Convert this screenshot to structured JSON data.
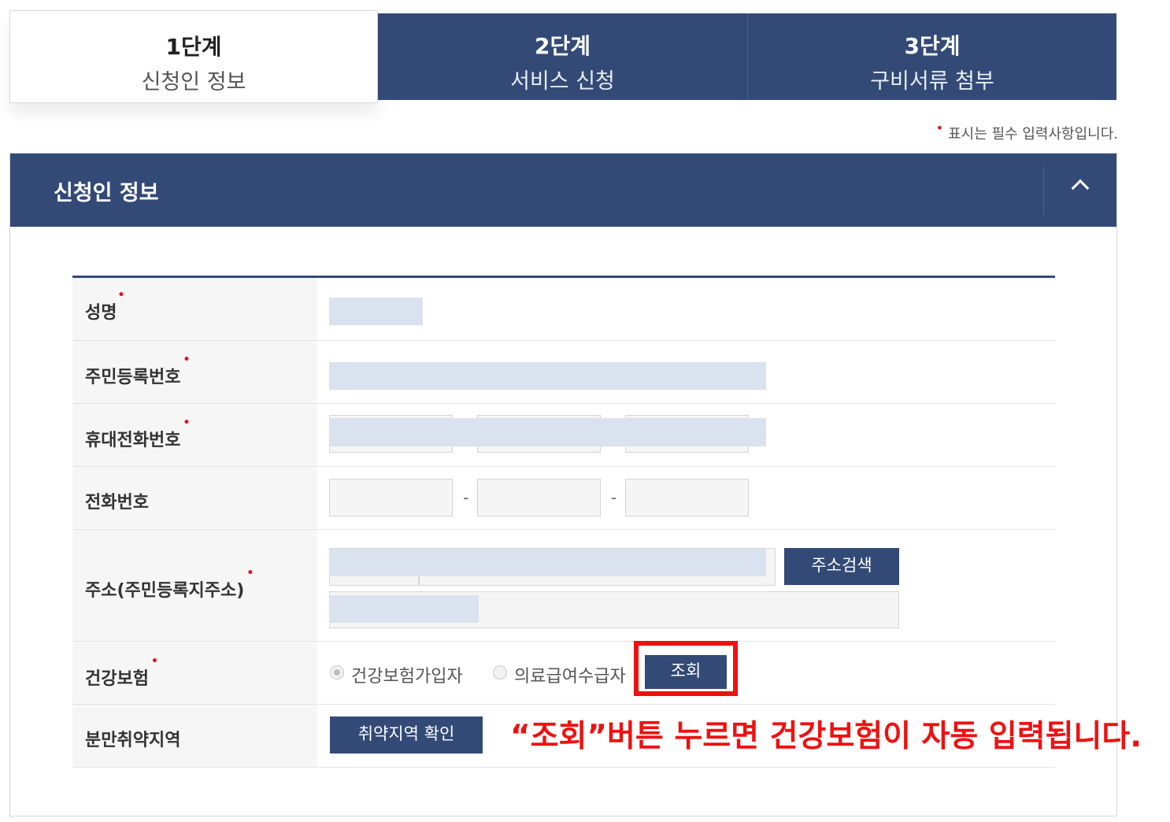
{
  "steps": [
    {
      "num": "1단계",
      "name": "신청인 정보"
    },
    {
      "num": "2단계",
      "name": "서비스 신청"
    },
    {
      "num": "3단계",
      "name": "구비서류 첨부"
    }
  ],
  "required_note": {
    "mark": "•",
    "text": "표시는 필수 입력사항입니다."
  },
  "section": {
    "title": "신청인 정보",
    "toggle_icon": "chevron-up-icon"
  },
  "form": {
    "name_label": "성명",
    "rrn_label": "주민등록번호",
    "mobile_label": "휴대전화번호",
    "phone_label": "전화번호",
    "phone_sep": "-",
    "address_label": "주소(주민등록지주소)",
    "address_search_button": "주소검색",
    "insurance_label": "건강보험",
    "insurance_options": [
      "건강보험가입자",
      "의료급여수급자"
    ],
    "insurance_selected": "건강보험가입자",
    "lookup_button": "조회",
    "region_label": "분만취약지역",
    "region_button": "취약지역 확인"
  },
  "annotation": "“조회”버튼 누르면 건강보험이 자동 입력됩니다.",
  "colors": {
    "navy": "#334a77",
    "required": "#e0141e",
    "annotation": "#ee1111",
    "mask": "#dae2ef"
  }
}
